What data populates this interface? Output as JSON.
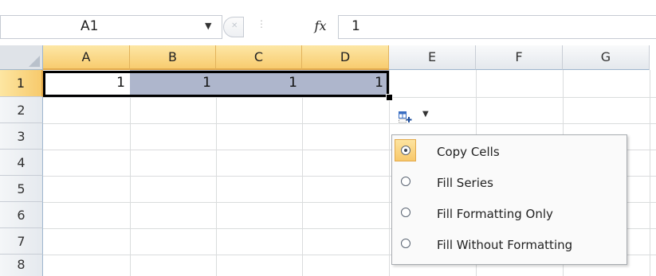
{
  "formula_bar": {
    "name_box": "A1",
    "fx_label": "fx",
    "formula_value": "1"
  },
  "columns": [
    "A",
    "B",
    "C",
    "D",
    "E",
    "F",
    "G"
  ],
  "rows": [
    "1",
    "2",
    "3",
    "4",
    "5",
    "6",
    "7",
    "8"
  ],
  "cells": {
    "A1": "1",
    "B1": "1",
    "C1": "1",
    "D1": "1"
  },
  "autofill_menu": {
    "items": [
      {
        "label": "Copy Cells",
        "checked": true
      },
      {
        "label": "Fill Series",
        "checked": false
      },
      {
        "label": "Fill Formatting Only",
        "checked": false
      },
      {
        "label": "Fill Without Formatting",
        "checked": false
      }
    ]
  },
  "colors": {
    "selected_header": "#f8cc6f",
    "selection_shade": "#aeb6cc",
    "gridline": "#dadcdd"
  }
}
